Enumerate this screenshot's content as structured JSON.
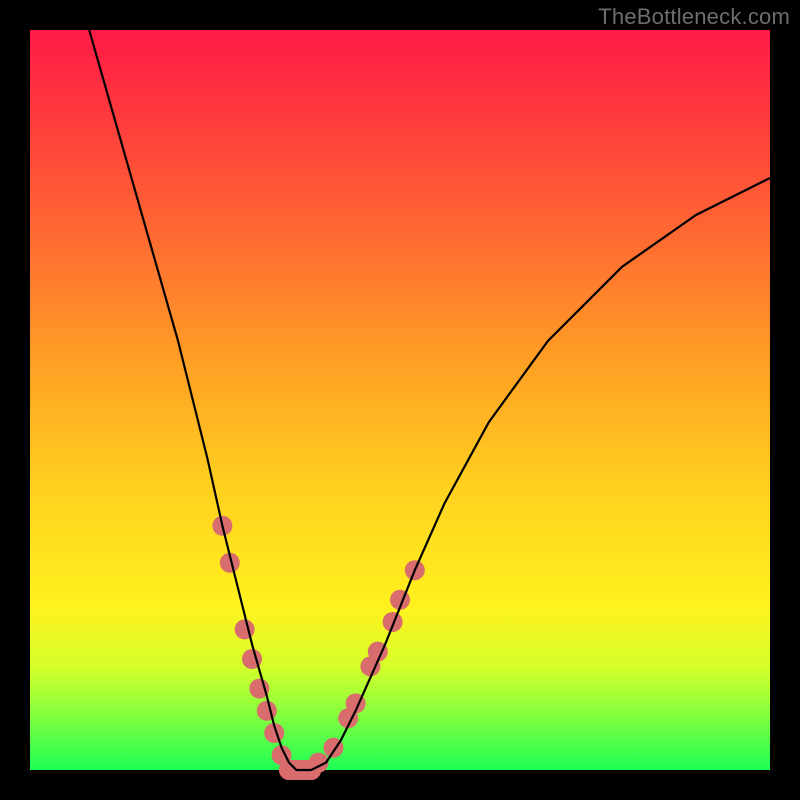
{
  "watermark": "TheBottleneck.com",
  "colors": {
    "frame": "#000000",
    "marker": "#d96c6c",
    "gradient_top": "#ff1a47",
    "gradient_bottom": "#1dff55"
  },
  "chart_data": {
    "type": "line",
    "title": "",
    "xlabel": "",
    "ylabel": "",
    "xlim": [
      0,
      100
    ],
    "ylim": [
      0,
      100
    ],
    "grid": false,
    "legend": false,
    "note": "V-shaped curve. Values are bottleneck-percentage (y, 0=bottom/green, 100=top/red) vs an unlabeled horizontal axis (x, 0–100).",
    "series": [
      {
        "name": "curve",
        "x": [
          8,
          12,
          16,
          20,
          24,
          26,
          28,
          30,
          32,
          33,
          34,
          35,
          36,
          38,
          40,
          42,
          44,
          48,
          52,
          56,
          62,
          70,
          80,
          90,
          100
        ],
        "y": [
          100,
          86,
          72,
          58,
          42,
          33,
          25,
          17,
          10,
          6,
          3,
          1,
          0,
          0,
          1,
          4,
          8,
          17,
          27,
          36,
          47,
          58,
          68,
          75,
          80
        ]
      }
    ],
    "markers": {
      "name": "highlighted-points",
      "note": "Salmon dots/pills clustered around the valley of the V.",
      "points": [
        {
          "x": 26,
          "y": 33
        },
        {
          "x": 27,
          "y": 28
        },
        {
          "x": 29,
          "y": 19
        },
        {
          "x": 30,
          "y": 15
        },
        {
          "x": 31,
          "y": 11
        },
        {
          "x": 32,
          "y": 8
        },
        {
          "x": 33,
          "y": 5
        },
        {
          "x": 34,
          "y": 2
        },
        {
          "x": 35,
          "y": 0
        },
        {
          "x": 36,
          "y": 0
        },
        {
          "x": 37,
          "y": 0
        },
        {
          "x": 38,
          "y": 0
        },
        {
          "x": 39,
          "y": 1
        },
        {
          "x": 41,
          "y": 3
        },
        {
          "x": 43,
          "y": 7
        },
        {
          "x": 44,
          "y": 9
        },
        {
          "x": 46,
          "y": 14
        },
        {
          "x": 47,
          "y": 16
        },
        {
          "x": 49,
          "y": 20
        },
        {
          "x": 50,
          "y": 23
        },
        {
          "x": 52,
          "y": 27
        }
      ]
    }
  }
}
